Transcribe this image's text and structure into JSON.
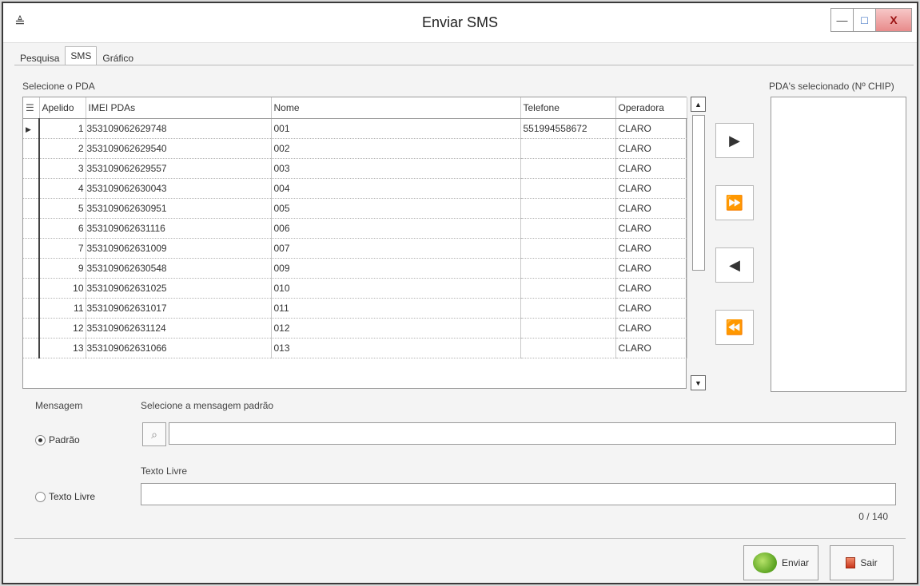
{
  "window": {
    "title": "Enviar SMS",
    "icon": "app-icon",
    "controls": {
      "minimize": "—",
      "maximize": "□",
      "close": "X"
    }
  },
  "tabs": [
    {
      "label": "Pesquisa"
    },
    {
      "label": "SMS",
      "active": true
    },
    {
      "label": "Gráfico"
    }
  ],
  "pda_section": {
    "label": "Selecione o PDA"
  },
  "grid": {
    "columns": [
      "Apelido",
      "IMEI PDAs",
      "Nome",
      "Telefone",
      "Operadora"
    ],
    "rows": [
      {
        "apelido": "1",
        "imei": "353109062629748",
        "nome": "001",
        "telefone": "551994558672",
        "operadora": "CLARO"
      },
      {
        "apelido": "2",
        "imei": "353109062629540",
        "nome": "002",
        "telefone": "",
        "operadora": "CLARO"
      },
      {
        "apelido": "3",
        "imei": "353109062629557",
        "nome": "003",
        "telefone": "",
        "operadora": "CLARO"
      },
      {
        "apelido": "4",
        "imei": "353109062630043",
        "nome": "004",
        "telefone": "",
        "operadora": "CLARO"
      },
      {
        "apelido": "5",
        "imei": "353109062630951",
        "nome": "005",
        "telefone": "",
        "operadora": "CLARO"
      },
      {
        "apelido": "6",
        "imei": "353109062631116",
        "nome": "006",
        "telefone": "",
        "operadora": "CLARO"
      },
      {
        "apelido": "7",
        "imei": "353109062631009",
        "nome": "007",
        "telefone": "",
        "operadora": "CLARO"
      },
      {
        "apelido": "9",
        "imei": "353109062630548",
        "nome": "009",
        "telefone": "",
        "operadora": "CLARO"
      },
      {
        "apelido": "10",
        "imei": "353109062631025",
        "nome": "010",
        "telefone": "",
        "operadora": "CLARO"
      },
      {
        "apelido": "11",
        "imei": "353109062631017",
        "nome": "011",
        "telefone": "",
        "operadora": "CLARO"
      },
      {
        "apelido": "12",
        "imei": "353109062631124",
        "nome": "012",
        "telefone": "",
        "operadora": "CLARO"
      },
      {
        "apelido": "13",
        "imei": "353109062631066",
        "nome": "013",
        "telefone": "",
        "operadora": "CLARO"
      }
    ]
  },
  "move_buttons": [
    {
      "name": "move-one-right-button",
      "glyph": "▶"
    },
    {
      "name": "move-all-right-button",
      "glyph": "⏩"
    },
    {
      "name": "move-one-left-button",
      "glyph": "◀"
    },
    {
      "name": "move-all-left-button",
      "glyph": "⏪"
    }
  ],
  "selected_section": {
    "label": "PDA's selecionado (Nº CHIP)"
  },
  "message": {
    "label": "Mensagem",
    "default_label": "Selecione a mensagem padrão",
    "radio_padrao": "Padrão",
    "radio_livre": "Texto Livre",
    "free_text_label": "Texto Livre",
    "selected": "padrao",
    "default_value": "",
    "free_text_value": "",
    "counter": "0 / 140"
  },
  "buttons": {
    "enviar": "Enviar",
    "sair": "Sair"
  }
}
